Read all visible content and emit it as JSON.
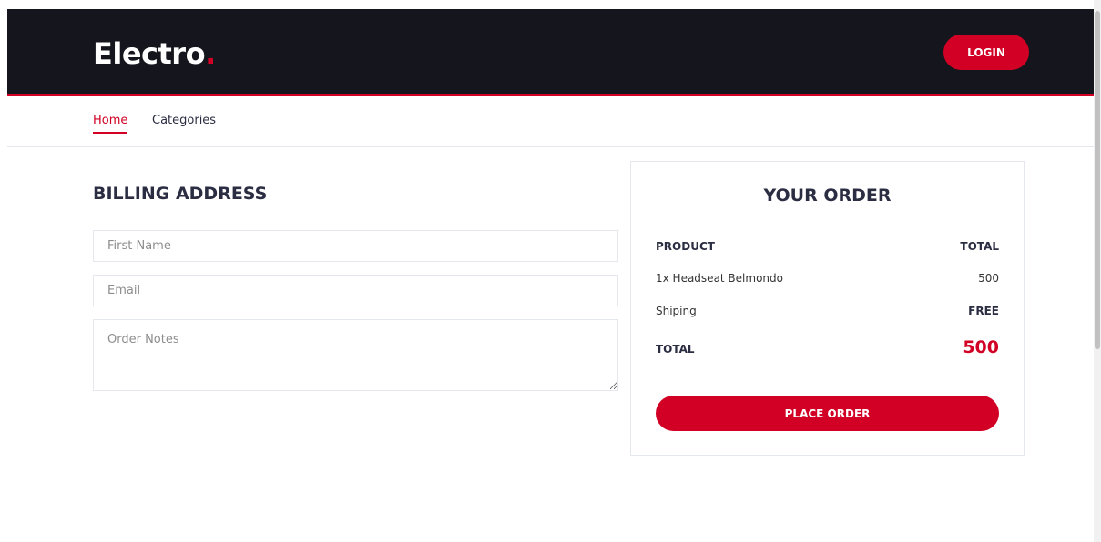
{
  "header": {
    "logo_text": "Electro",
    "logo_dot": ".",
    "login_label": "LOGIN"
  },
  "nav": {
    "items": [
      {
        "label": "Home",
        "active": true
      },
      {
        "label": "Categories",
        "active": false
      }
    ]
  },
  "billing": {
    "title": "BILLING ADDRESS",
    "fields": {
      "first_name_placeholder": "First Name",
      "email_placeholder": "Email",
      "notes_placeholder": "Order Notes"
    }
  },
  "order": {
    "title": "YOUR ORDER",
    "product_header": "PRODUCT",
    "total_header": "TOTAL",
    "items": [
      {
        "name": "1x Headseat Belmondo",
        "price": "500"
      }
    ],
    "shipping_label": "Shiping",
    "shipping_value": "FREE",
    "total_label": "TOTAL",
    "total_value": "500",
    "place_order_label": "PLACE ORDER"
  },
  "colors": {
    "accent": "#d10024",
    "header_bg": "#15161d",
    "text_dark": "#2b2d42"
  }
}
